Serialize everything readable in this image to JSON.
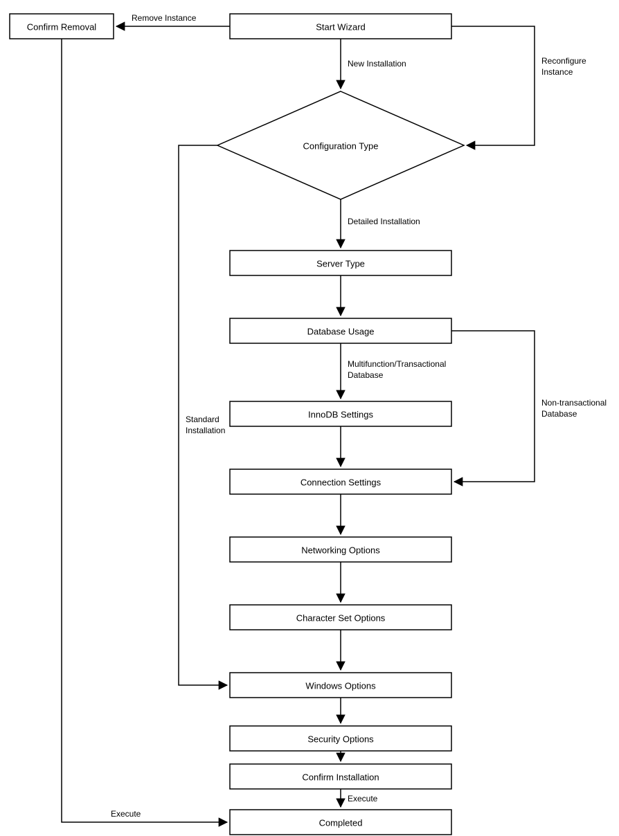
{
  "nodes": {
    "start_wizard": "Start Wizard",
    "confirm_removal": "Confirm Removal",
    "configuration_type": "Configuration Type",
    "server_type": "Server Type",
    "database_usage": "Database Usage",
    "innodb_settings": "InnoDB Settings",
    "connection_settings": "Connection Settings",
    "networking_options": "Networking Options",
    "character_set_options": "Character Set Options",
    "windows_options": "Windows Options",
    "security_options": "Security Options",
    "confirm_installation": "Confirm Installation",
    "completed": "Completed"
  },
  "edges": {
    "remove_instance": "Remove Instance",
    "new_installation": "New Installation",
    "reconfigure_instance_1": "Reconfigure",
    "reconfigure_instance_2": "Instance",
    "detailed_installation": "Detailed Installation",
    "standard_installation_1": "Standard",
    "standard_installation_2": "Installation",
    "multifunction_1": "Multifunction/Transactional",
    "multifunction_2": "Database",
    "nontransactional_1": "Non-transactional",
    "nontransactional_2": "Database",
    "execute_top": "Execute",
    "execute_bottom": "Execute"
  }
}
